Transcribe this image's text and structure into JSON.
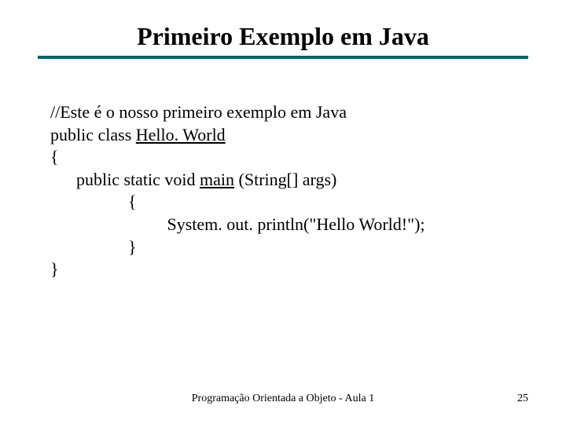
{
  "title": "Primeiro Exemplo em Java",
  "code": {
    "l1": "//Este é o nosso primeiro exemplo em Java",
    "l2a": "public class ",
    "l2b": "Hello. World",
    "l3": "{",
    "l4a": "      public static void ",
    "l4b": "main",
    "l4c": " (String[] args)",
    "l5": "                  {",
    "l6": "                           System. out. println(\"Hello World!\");",
    "l7": "                  }",
    "l8": "}"
  },
  "footer": {
    "center": "Programação Orientada a Objeto - Aula 1",
    "page": "25"
  }
}
